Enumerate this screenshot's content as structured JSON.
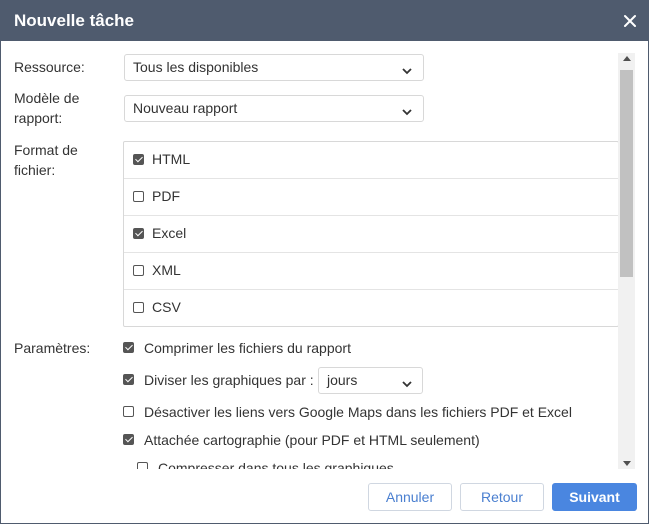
{
  "dialog": {
    "title": "Nouvelle tâche"
  },
  "form": {
    "resource_label": "Ressource:",
    "resource_value": "Tous les disponibles",
    "template_label": "Modèle de rapport:",
    "template_label_line1": "Modèle de",
    "template_label_line2": "rapport:",
    "template_value": "Nouveau rapport",
    "format_label_line1": "Format de",
    "format_label_line2": "fichier:",
    "formats": [
      {
        "label": "HTML",
        "checked": true
      },
      {
        "label": "PDF",
        "checked": false
      },
      {
        "label": "Excel",
        "checked": true
      },
      {
        "label": "XML",
        "checked": false
      },
      {
        "label": "CSV",
        "checked": false
      }
    ],
    "params_label": "Paramètres:",
    "params": {
      "compress": {
        "label": "Comprimer les fichiers du rapport",
        "checked": true
      },
      "split": {
        "label": "Diviser les graphiques par :",
        "checked": true,
        "unit": "jours"
      },
      "disable_links": {
        "label": "Désactiver les liens vers Google Maps dans les fichiers PDF et Excel",
        "checked": false
      },
      "attach_map": {
        "label": "Attachée cartographie (pour PDF et HTML seulement)",
        "checked": true
      },
      "compress_all": {
        "label": "Compresser dans tous les graphiques",
        "checked": false
      }
    }
  },
  "buttons": {
    "cancel": "Annuler",
    "back": "Retour",
    "next": "Suivant"
  },
  "colors": {
    "titlebar": "#4f5b6e",
    "accent": "#4a86e0",
    "link": "#4a7fd0"
  }
}
